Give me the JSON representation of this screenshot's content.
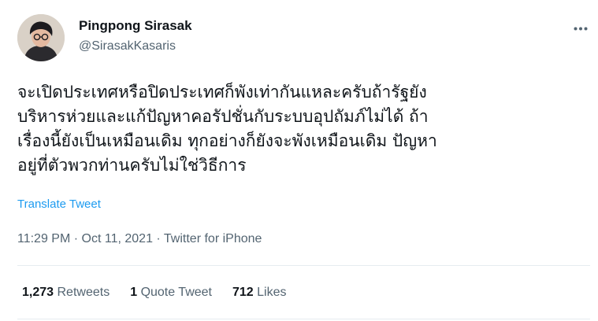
{
  "user": {
    "display_name": "Pingpong Sirasak",
    "handle": "@SirasakKasaris"
  },
  "tweet": {
    "lines": [
      "จะเปิดประเทศหรือปิดประเทศก็พังเท่ากันแหละครับถ้ารัฐยัง",
      "บริหารห่วยและแก้ปัญหาคอรัปชั่นกับระบบอุปถัมภ์ไม่ได้ ถ้า",
      "เรื่องนี้ยังเป็นเหมือนเดิม ทุกอย่างก็ยังจะพังเหมือนเดิม ปัญหา",
      "อยู่ที่ตัวพวกท่านครับไม่ใช่วิธีการ"
    ],
    "translate_label": "Translate Tweet",
    "time": "11:29 PM",
    "separator": "·",
    "date": "Oct 11, 2021",
    "source": "Twitter for iPhone"
  },
  "stats": {
    "retweets_count": "1,273",
    "retweets_label": "Retweets",
    "quotes_count": "1",
    "quotes_label": "Quote Tweet",
    "likes_count": "712",
    "likes_label": "Likes"
  },
  "colors": {
    "link": "#1d9bf0",
    "secondary_text": "#536471",
    "divider": "#e6ecf0"
  },
  "icons": {
    "more": "more-horizontal-icon"
  }
}
